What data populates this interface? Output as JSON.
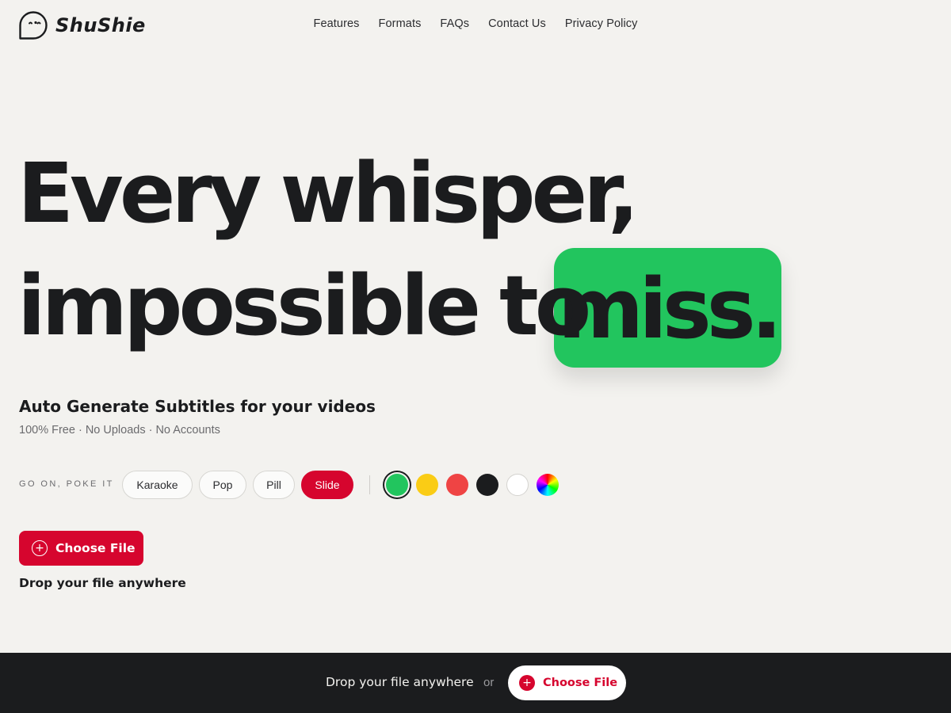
{
  "brand": {
    "name": "ShuShie"
  },
  "nav": {
    "items": [
      "Features",
      "Formats",
      "FAQs",
      "Contact Us",
      "Privacy Policy"
    ]
  },
  "hero": {
    "line1_word1": "Every",
    "line1_word2": "whisper,",
    "line2_word1": "impossible",
    "line2_word2": "to",
    "highlight_word": "miss.",
    "subtitle": "Auto Generate Subtitles for your videos",
    "tagline": "100% Free · No Uploads · No Accounts"
  },
  "style_picker": {
    "label": "GO ON, POKE IT",
    "styles": [
      "Karaoke",
      "Pop",
      "Pill",
      "Slide"
    ],
    "active_style": "Slide",
    "colors": [
      "#22c55e",
      "#facc15",
      "#ef4444",
      "#1b1c1e",
      "#ffffff",
      "rainbow"
    ],
    "selected_color": "#22c55e"
  },
  "upload": {
    "button_label": "Choose File",
    "button_icon": "plus-circle-icon",
    "drop_text": "Drop your file anywhere"
  },
  "bottom_bar": {
    "drop_text": "Drop your file anywhere",
    "or_text": "or",
    "button_label": "Choose File",
    "button_icon": "plus-circle-icon"
  },
  "colors": {
    "background": "#f3f2ef",
    "accent": "#d6052e",
    "highlight": "#22c55e",
    "dark": "#1b1c1e"
  }
}
